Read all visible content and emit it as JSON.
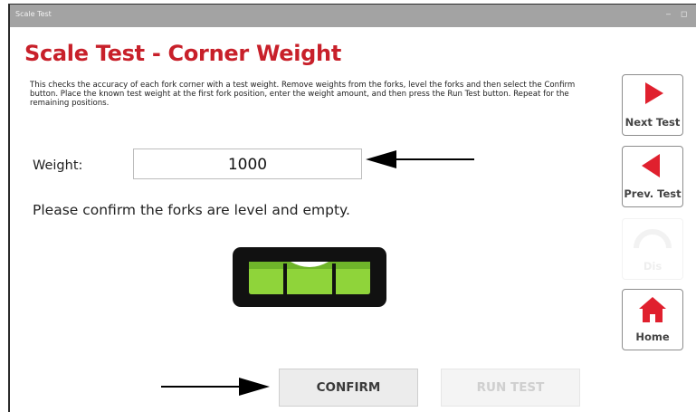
{
  "window": {
    "title": "Scale Test",
    "minimize_glyph": "–",
    "maximize_glyph": "◻"
  },
  "page": {
    "heading": "Scale Test - Corner Weight",
    "description": "This checks the accuracy of each fork corner with a test weight. Remove weights from the forks, level the forks and then select the Confirm button. Place the known test weight at the first fork position, enter the weight amount, and then press the Run Test button. Repeat for the remaining positions.",
    "weight_label": "Weight:",
    "weight_value": "1000",
    "prompt": "Please confirm the forks are level and empty."
  },
  "sidebar": {
    "next_test": "Next Test",
    "prev_test": "Prev. Test",
    "disabled_button": "Dis",
    "home": "Home"
  },
  "buttons": {
    "confirm": "CONFIRM",
    "run_test": "RUN TEST"
  },
  "colors": {
    "accent": "#c8202a",
    "titlebar": "#a3a3a3",
    "level_green": "#8fd43a",
    "level_body": "#111111"
  },
  "icons": [
    "play-right-icon",
    "play-left-icon",
    "gauge-icon",
    "home-icon",
    "spirit-level-icon",
    "arrow-left-icon",
    "arrow-right-icon"
  ]
}
